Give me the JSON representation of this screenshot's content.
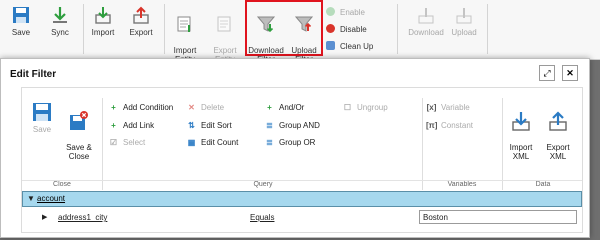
{
  "background_ribbon": {
    "save": "Save",
    "sync": "Sync",
    "import": "Import",
    "export": "Export",
    "import_entity": "Import\nEntity",
    "export_entity": "Export\nEntity",
    "download_filter": "Download\nFilter",
    "upload_filter": "Upload\nFilter",
    "enable": "Enable",
    "disable": "Disable",
    "clean_up": "Clean Up",
    "download": "Download",
    "upload": "Upload"
  },
  "dialog": {
    "title": "Edit Filter",
    "expand_icon": "expand-icon",
    "close_icon": "close-icon"
  },
  "ribbon": {
    "save": "Save",
    "save_close": "Save &\nClose",
    "add_condition": "Add Condition",
    "add_link": "Add Link",
    "select": "Select",
    "delete": "Delete",
    "edit_sort": "Edit Sort",
    "edit_count": "Edit Count",
    "and_or": "And/Or",
    "group_and": "Group AND",
    "group_or": "Group OR",
    "ungroup": "Ungroup",
    "variable": "Variable",
    "constant": "Constant",
    "import_xml": "Import\nXML",
    "export_xml": "Export\nXML",
    "groups": {
      "close": "Close",
      "query": "Query",
      "variables": "Variables",
      "data": "Data"
    }
  },
  "tree": {
    "entity": "account",
    "condition": {
      "field": "address1_city",
      "operator": "Equals",
      "value": "Boston"
    }
  },
  "colors": {
    "highlight": "#e0141e",
    "row_selected": "#a6d8ee",
    "add_green": "#2e9e3e",
    "delete_red": "#d9342b"
  }
}
